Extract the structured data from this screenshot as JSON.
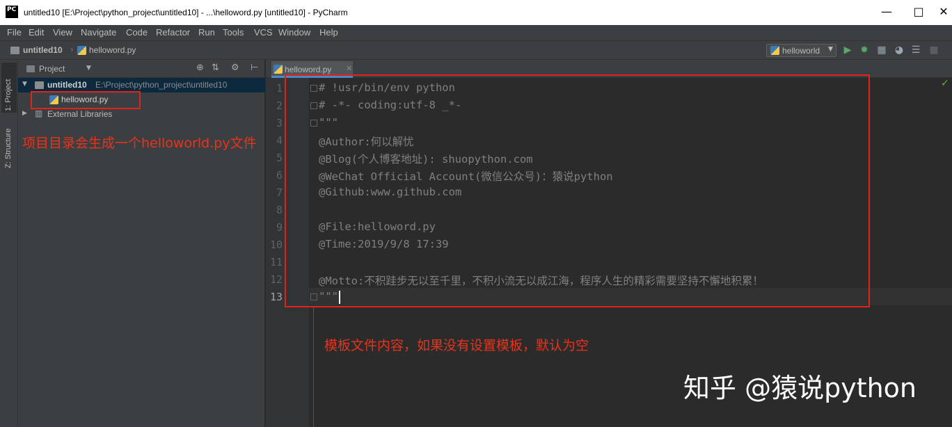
{
  "window": {
    "logo": "PC",
    "title": "untitled10 [E:\\Project\\python_project\\untitled10] - ...\\helloword.py [untitled10] - PyCharm",
    "controls": [
      "—",
      "□",
      "✕"
    ]
  },
  "menu": [
    "File",
    "Edit",
    "View",
    "Navigate",
    "Code",
    "Refactor",
    "Run",
    "Tools",
    "VCS",
    "Window",
    "Help"
  ],
  "breadcrumb": {
    "project": "untitled10",
    "file": "helloword.py"
  },
  "toolbar": {
    "run_config": "helloworld"
  },
  "tool_stripe": {
    "project_tab": "1: Project",
    "structure_tab": "Z: Structure"
  },
  "project_pane": {
    "header": "Project",
    "root_name": "untitled10",
    "root_path": "E:\\Project\\python_project\\untitled10",
    "file": "helloword.py",
    "external": "External Libraries"
  },
  "editor": {
    "tab": "helloword.py",
    "line_numbers": [
      "1",
      "2",
      "3",
      "4",
      "5",
      "6",
      "7",
      "8",
      "9",
      "10",
      "11",
      "12",
      "13"
    ],
    "lines": [
      "# !usr/bin/env python",
      "# -*- coding:utf-8 _*-",
      "\"\"\"",
      "@Author:何以解忧",
      "@Blog(个人博客地址): shuopython.com",
      "@WeChat Official Account(微信公众号)：猿说python",
      "@Github:www.github.com",
      "",
      "@File:helloword.py",
      "@Time:2019/9/8 17:39",
      "",
      "@Motto:不积跬步无以至千里，不积小流无以成江海，程序人生的精彩需要坚持不懈地积累！",
      "\"\"\""
    ]
  },
  "annotations": {
    "project_note": "项目目录会生成一个helloworld.py文件",
    "editor_note": "模板文件内容，如果没有设置模板，默认为空",
    "watermark": "知乎 @猿说python"
  },
  "colors": {
    "annotation_red": "#e0241b",
    "background": "#2b2b2b",
    "selection": "#0d293e"
  }
}
